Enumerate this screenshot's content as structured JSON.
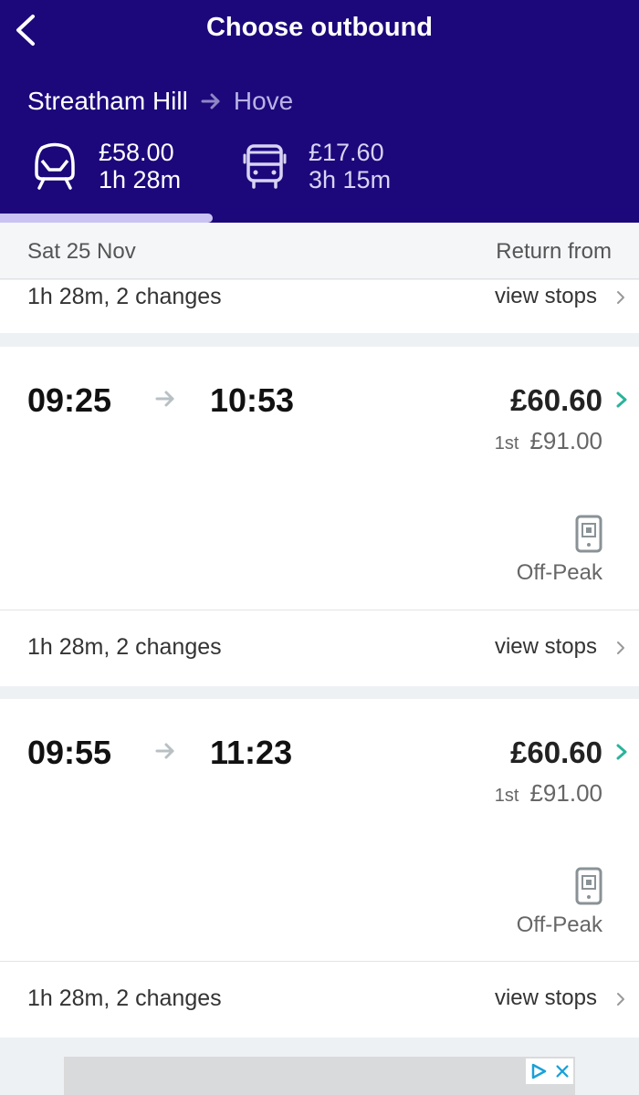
{
  "header": {
    "title": "Choose outbound",
    "route_from": "Streatham Hill",
    "route_to": "Hove",
    "modes": [
      {
        "price": "£58.00",
        "duration": "1h 28m"
      },
      {
        "price": "£17.60",
        "duration": "3h 15m"
      }
    ]
  },
  "date_row": {
    "date": "Sat 25 Nov",
    "return_label": "Return from"
  },
  "partial_row": {
    "summary": "1h 28m, 2 changes",
    "view_stops": "view stops"
  },
  "journeys": [
    {
      "depart": "09:25",
      "arrive": "10:53",
      "price": "£60.60",
      "first_class_label": "1st",
      "first_class_price": "£91.00",
      "fare_type": "Off-Peak",
      "summary": "1h 28m, 2 changes",
      "view_stops": "view stops"
    },
    {
      "depart": "09:55",
      "arrive": "11:23",
      "price": "£60.60",
      "first_class_label": "1st",
      "first_class_price": "£91.00",
      "fare_type": "Off-Peak",
      "summary": "1h 28m, 2 changes",
      "view_stops": "view stops"
    }
  ],
  "colors": {
    "header_bg": "#1c087a",
    "accent_chevron": "#2bb39b",
    "tab_indicator": "#c9c2f2"
  },
  "icons": [
    "back-chevron-icon",
    "train-icon",
    "bus-icon",
    "arrow-right-icon",
    "chevron-right-icon",
    "mobile-ticket-icon",
    "ad-choices-icon",
    "close-icon"
  ]
}
